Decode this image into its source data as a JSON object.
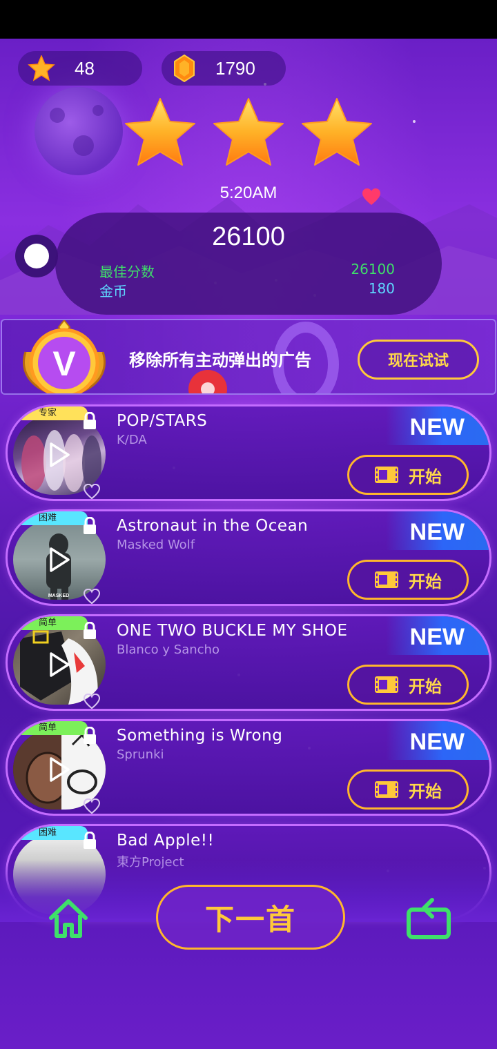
{
  "header": {
    "stars_count": "48",
    "gems_count": "1790",
    "level_stars": 3,
    "time": "5:20AM"
  },
  "score": {
    "current": "26100",
    "best_label": "最佳分数",
    "best_value": "26100",
    "coins_label": "金币",
    "coins_value": "180"
  },
  "vip_banner": {
    "badge_letter": "V",
    "text": "移除所有主动弹出的广告",
    "button": "现在试试"
  },
  "songs": [
    {
      "title": "POP/STARS",
      "artist": "K/DA",
      "difficulty": "专家",
      "tag": "NEW",
      "button": "开始"
    },
    {
      "title": "Astronaut in the Ocean",
      "artist": "Masked Wolf",
      "difficulty": "困难",
      "tag": "NEW",
      "button": "开始",
      "thumb_caption": "MASKED"
    },
    {
      "title": "ONE TWO BUCKLE MY SHOE",
      "artist": "Blanco y Sancho",
      "difficulty": "简单",
      "tag": "NEW",
      "button": "开始"
    },
    {
      "title": "Something is Wrong",
      "artist": "Sprunki",
      "difficulty": "简单",
      "tag": "NEW",
      "button": "开始"
    },
    {
      "title": "Bad Apple!!",
      "artist": "東方Project",
      "difficulty": "困难"
    }
  ],
  "bottom": {
    "next_button": "下一首"
  },
  "colors": {
    "accent_gold": "#ffc93a",
    "green_label": "#3fe06a",
    "cyan_label": "#5fd8ff",
    "badge_expert": "#ffe15a",
    "badge_hard": "#59e6ff",
    "badge_easy": "#7cf05a",
    "nav_icon": "#3fe06a"
  },
  "icons": [
    "star-icon",
    "gem-icon",
    "heart-icon",
    "lock-icon",
    "play-icon",
    "video-icon",
    "home-icon",
    "replay-icon",
    "vip-badge-icon"
  ]
}
